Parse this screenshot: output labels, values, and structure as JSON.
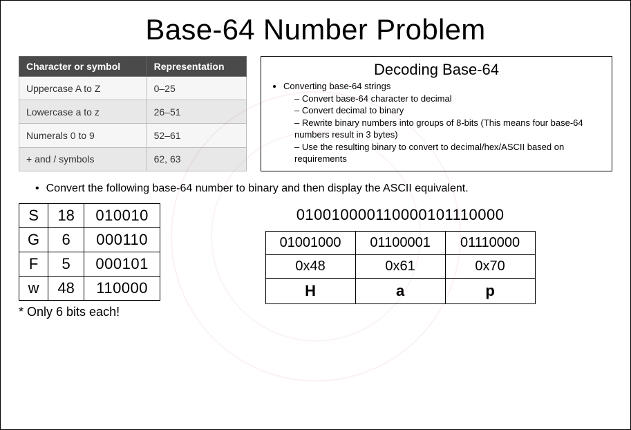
{
  "title": "Base-64 Number Problem",
  "map": {
    "headers": [
      "Character or symbol",
      "Representation"
    ],
    "rows": [
      [
        "Uppercase A to Z",
        "0–25"
      ],
      [
        "Lowercase a to z",
        "26–51"
      ],
      [
        "Numerals 0 to 9",
        "52–61"
      ],
      [
        "+ and / symbols",
        "62, 63"
      ]
    ]
  },
  "decode": {
    "heading": "Decoding Base-64",
    "lead": "Converting base-64 strings",
    "steps": [
      "Convert base-64 character to decimal",
      "Convert decimal to binary",
      "Rewrite binary numbers into groups of 8-bits (This means four base-64 numbers result in 3 bytes)",
      "Use the resulting binary to convert to decimal/hex/ASCII based on requirements"
    ]
  },
  "instruction": "Convert the following base-64 number to binary and then display the ASCII equivalent.",
  "conv": {
    "rows": [
      [
        "S",
        "18",
        "010010"
      ],
      [
        "G",
        "6",
        "000110"
      ],
      [
        "F",
        "5",
        "000101"
      ],
      [
        "w",
        "48",
        "110000"
      ]
    ],
    "footnote": "* Only 6 bits each!"
  },
  "result": {
    "bitstring": "010010000110000101110000",
    "bytes": [
      "01001000",
      "01100001",
      "01110000"
    ],
    "hex": [
      "0x48",
      "0x61",
      "0x70"
    ],
    "ascii": [
      "H",
      "a",
      "p"
    ]
  }
}
